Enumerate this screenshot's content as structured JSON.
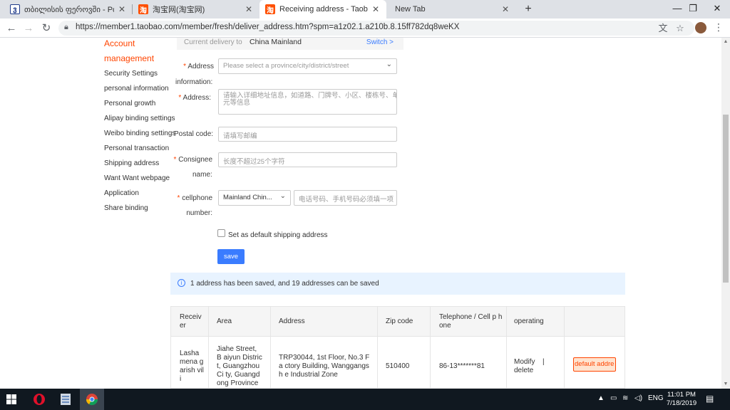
{
  "browser": {
    "tabs": [
      {
        "title": "თბილისის ფეროვში - Powere",
        "active": false
      },
      {
        "title": "淘宝网(淘宝网)",
        "active": false
      },
      {
        "title": "Receiving address - Taobao",
        "active": true
      },
      {
        "title": "New Tab",
        "active": false
      }
    ],
    "url": "https://member1.taobao.com/member/fresh/deliver_address.htm?spm=a1z02.1.a210b.8.15ff782dq8weKX"
  },
  "sidebar": {
    "title_line1": "Account",
    "title_line2": "management",
    "items": [
      {
        "label": "Security Settings"
      },
      {
        "label": "personal information"
      },
      {
        "label": "Personal growth"
      },
      {
        "label": "Alipay binding settings"
      },
      {
        "label": "Weibo binding settings"
      },
      {
        "label": "Personal transaction"
      },
      {
        "label": "Shipping address"
      },
      {
        "label": "Want Want webpage"
      },
      {
        "label": "Application"
      },
      {
        "label": "Share binding"
      }
    ]
  },
  "delivery": {
    "label": "Current delivery to",
    "value": "China Mainland",
    "switch": "Switch >"
  },
  "form": {
    "address_info_label_1": "Address",
    "address_info_label_2": "information:",
    "address_info_placeholder": "Please select a province/city/district/street",
    "address_label": "Address:",
    "address_placeholder_1": "请输入详细地址信息，如道路、门牌号、小区、楼栋号、单",
    "address_placeholder_2": "元等信息",
    "postal_label": "Postal code:",
    "postal_placeholder": "请填写邮编",
    "consignee_label_1": "Consignee",
    "consignee_label_2": "name:",
    "consignee_placeholder": "长度不超过25个字符",
    "cellphone_label_1": "cellphone",
    "cellphone_label_2": "number:",
    "country_value": "Mainland Chin...",
    "phone_placeholder": "电话号码、手机号码必须填一项",
    "default_checkbox_label": "Set as default shipping address",
    "save_label": "save",
    "required_mark": "*"
  },
  "info": {
    "icon": "i",
    "text": "1 address has been saved, and 19 addresses can be saved"
  },
  "table": {
    "headers": [
      "Receiv er",
      "Area",
      "Address",
      "Zip code",
      "Telephone / Cell p hone",
      "operating"
    ],
    "row": {
      "receiver": "Lasha mena garish vili",
      "area": "Jiahe Street, B aiyun District, Guangzhou Ci ty, Guangdong Province",
      "address": "TRP30044, 1st Floor, No.3 Fa ctory Building, Wanggangsh e Industrial Zone",
      "zip": "510400",
      "phone": "86-13*******81",
      "modify": "Modify",
      "sep": "|",
      "delete": "delete",
      "default_btn": "default addre"
    }
  },
  "taskbar": {
    "lang": "ENG",
    "time": "11:01 PM",
    "date": "7/18/2019"
  },
  "colors": {
    "accent": "#ff4400",
    "primary": "#3a7cff",
    "info_bg": "#e8f3ff"
  }
}
